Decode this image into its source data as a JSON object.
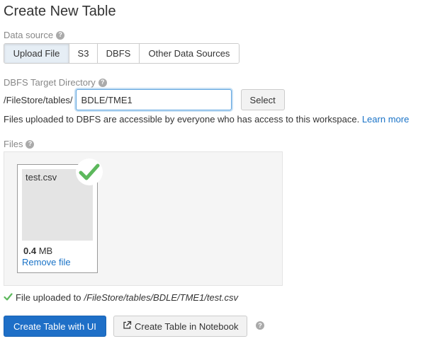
{
  "page": {
    "title": "Create New Table"
  },
  "data_source": {
    "label": "Data source",
    "help_icon": "question-circle-icon",
    "tabs": [
      {
        "label": "Upload File",
        "active": true
      },
      {
        "label": "S3",
        "active": false
      },
      {
        "label": "DBFS",
        "active": false
      },
      {
        "label": "Other Data Sources",
        "active": false
      }
    ]
  },
  "dbfs_target": {
    "label": "DBFS Target Directory",
    "help_icon": "question-circle-icon",
    "prefix": "/FileStore/tables/",
    "value": "BDLE/TME1",
    "select_label": "Select"
  },
  "info": {
    "text": "Files uploaded to DBFS are accessible by everyone who has access to this workspace.",
    "link_label": "Learn more"
  },
  "files": {
    "label": "Files",
    "help_icon": "question-circle-icon",
    "items": [
      {
        "name": "test.csv",
        "size_value": "0.4",
        "size_unit": "MB",
        "remove_label": "Remove file",
        "status_icon": "checkmark-icon"
      }
    ]
  },
  "upload_status": {
    "icon": "checkmark-icon",
    "text": "File uploaded to",
    "path": "/FileStore/tables/BDLE/TME1/test.csv"
  },
  "actions": {
    "primary_label": "Create Table with UI",
    "secondary_label": "Create Table in Notebook",
    "secondary_icon": "external-link-icon",
    "help_icon": "question-circle-icon"
  },
  "colors": {
    "accent": "#1e6fc7",
    "link": "#1a73c7",
    "success": "#5cb85c",
    "active_tab": "#e6eef5"
  }
}
